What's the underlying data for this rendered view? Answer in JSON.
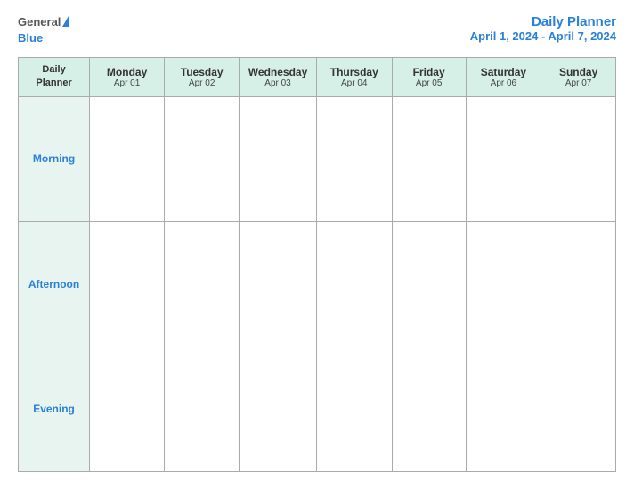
{
  "logo": {
    "general": "General",
    "blue": "Blue",
    "icon": "▶"
  },
  "title": {
    "main": "Daily Planner",
    "date_range": "April 1, 2024 - April 7, 2024"
  },
  "table": {
    "header_col": {
      "line1": "Daily",
      "line2": "Planner"
    },
    "days": [
      {
        "name": "Monday",
        "date": "Apr 01"
      },
      {
        "name": "Tuesday",
        "date": "Apr 02"
      },
      {
        "name": "Wednesday",
        "date": "Apr 03"
      },
      {
        "name": "Thursday",
        "date": "Apr 04"
      },
      {
        "name": "Friday",
        "date": "Apr 05"
      },
      {
        "name": "Saturday",
        "date": "Apr 06"
      },
      {
        "name": "Sunday",
        "date": "Apr 07"
      }
    ],
    "time_slots": [
      "Morning",
      "Afternoon",
      "Evening"
    ]
  }
}
